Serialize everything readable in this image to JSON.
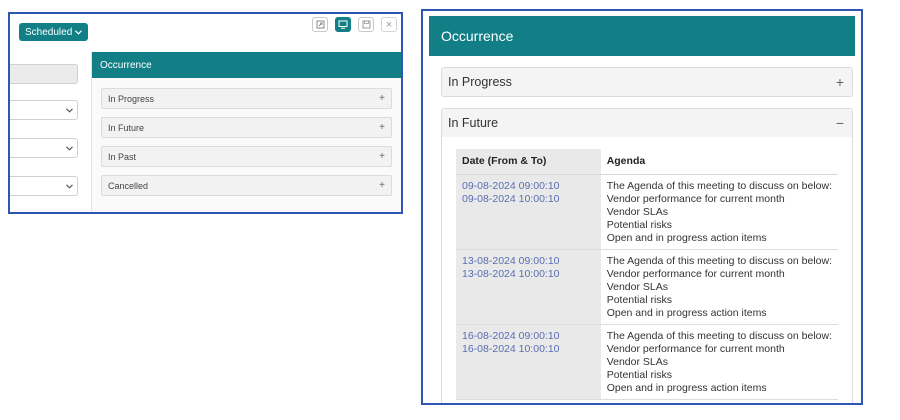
{
  "left": {
    "status_button": "Scheduled",
    "occurrence_title": "Occurrence",
    "accordion": [
      {
        "label": "In Progress"
      },
      {
        "label": "In Future"
      },
      {
        "label": "In Past"
      },
      {
        "label": "Cancelled"
      }
    ]
  },
  "right": {
    "occurrence_title": "Occurrence",
    "in_progress_label": "In Progress",
    "in_future_label": "In Future",
    "table": {
      "col_date": "Date (From & To)",
      "col_agenda": "Agenda",
      "rows": [
        {
          "from": "09-08-2024 09:00:10",
          "to": "09-08-2024 10:00:10",
          "agenda": [
            "The Agenda of this meeting to discuss on below:",
            "Vendor performance for current month",
            "Vendor SLAs",
            "Potential risks",
            "Open and in progress action items"
          ]
        },
        {
          "from": "13-08-2024 09:00:10",
          "to": "13-08-2024 10:00:10",
          "agenda": [
            "The Agenda of this meeting to discuss on below:",
            "Vendor performance for current month",
            "Vendor SLAs",
            "Potential risks",
            "Open and in progress action items"
          ]
        },
        {
          "from": "16-08-2024 09:00:10",
          "to": "16-08-2024 10:00:10",
          "agenda": [
            "The Agenda of this meeting to discuss on below:",
            "Vendor performance for current month",
            "Vendor SLAs",
            "Potential risks",
            "Open and in progress action items"
          ]
        }
      ]
    }
  },
  "icons": {
    "expand": "+",
    "collapse": "−",
    "dropdown": "chevron-down-icon",
    "close": "×"
  },
  "colors": {
    "accent": "#127f86",
    "frame_border": "#2f55b5",
    "date_link": "#5a6db4"
  }
}
